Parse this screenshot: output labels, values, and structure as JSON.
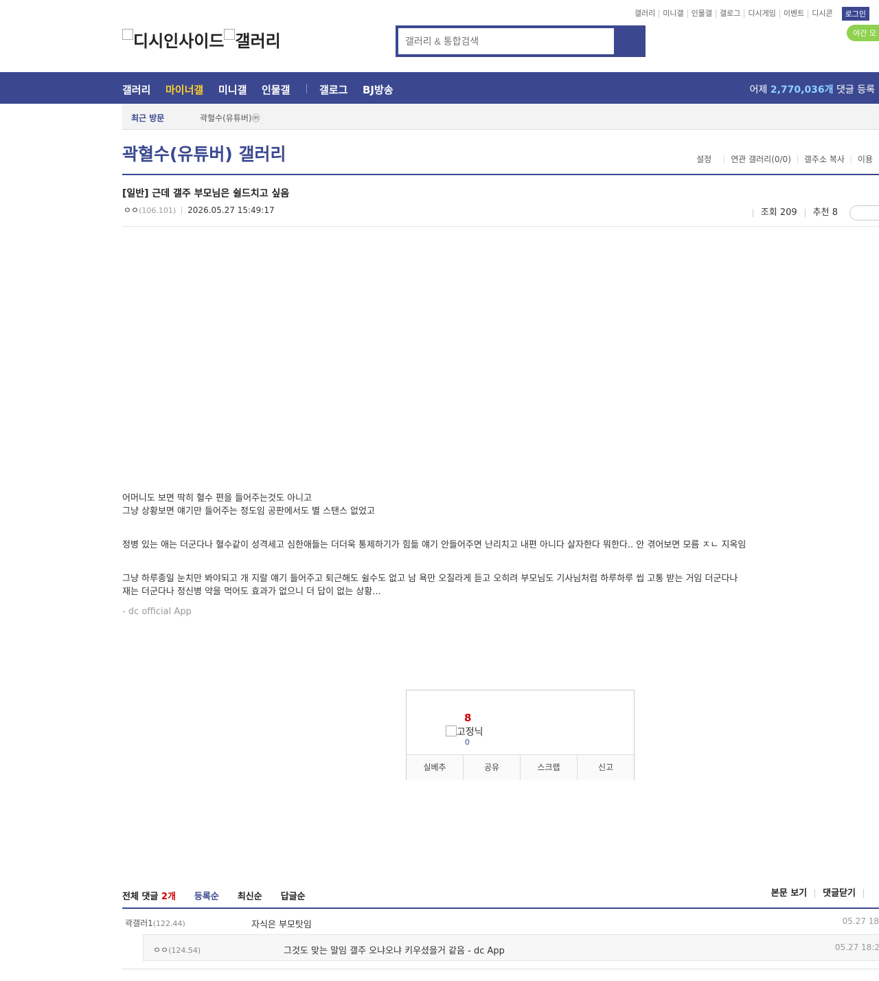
{
  "top_links": [
    "갤러리",
    "미니갤",
    "인물갤",
    "갤로그",
    "디시게임",
    "이벤트",
    "디시콘"
  ],
  "login_label": "로그인",
  "night_mode_label": "야간 모",
  "logo": {
    "left_alt": "디시인사이드",
    "right_alt": "갤러리"
  },
  "search": {
    "placeholder": "갤러리 & 통합검색"
  },
  "gnb": {
    "items": [
      "갤러리",
      "마이너갤",
      "미니갤",
      "인물갤"
    ],
    "items2": [
      "갤로그",
      "BJ방송"
    ],
    "stats_prefix": "어제",
    "stats_value": "2,770,036개",
    "stats_suffix": "댓글 등록"
  },
  "recent": {
    "label": "최근 방문",
    "gallery": "곽혈수(유튜버)ⓜ"
  },
  "gallery_title": "곽혈수(유튜버) 갤러리",
  "gallery_options": [
    "설정",
    "연관 갤러리(0/0)",
    "갤주소 복사",
    "이용"
  ],
  "post": {
    "title": "[일반] 근데 갤주 부모님은 쉴드치고 싶음",
    "author": "ㅇㅇ",
    "ip": "(106.101)",
    "date": "2026.05.27 15:49:17",
    "views": "조회 209",
    "recommend": "추천 8",
    "body": [
      "어머니도 보면 딱히 혈수 편을 들어주는것도 아니고",
      "그냥 상황보면 얘기만 들어주는 정도임 공판에서도 별 스탠스 없었고",
      "",
      "정병 있는 애는 더군다나 혈수같이 성격세고 심한애들는 더더욱 통제하기가 힘듦 얘기 안들어주면 난리치고 내편 아니다 살자한다 뭐한다.. 안 겪어보면 모름 ㅈㄴ 지옥임",
      "",
      "그냥 하루종일 눈치만 봐야되고 개 지랄 얘기 들어주고 퇴근해도 쉴수도 없고 남 욕만 오질라게 듣고 오히려 부모님도 기사님처럼 하루하루 씹 고통 받는 거임 더군다나 재는 더군다나 정신병 약을 먹어도 효과가 없으니 더 답이 없는 상황..."
    ],
    "app_signature": "- dc official App"
  },
  "recommend_box": {
    "count": "8",
    "fixed_nick_alt": "고정닉",
    "fixed_count": "0",
    "buttons": [
      "실베추",
      "공유",
      "스크랩",
      "신고"
    ]
  },
  "comments_header": {
    "label": "전체 댓글",
    "count": "2개",
    "sorts": [
      "등록순",
      "최신순",
      "답글순"
    ],
    "tools": [
      "본문 보기",
      "댓글닫기"
    ]
  },
  "comments": [
    {
      "nick": "곽갤러1",
      "ip": "(122.44)",
      "text": "자식은 부모탓임",
      "date": "05.27 18"
    },
    {
      "nick": "ㅇㅇ",
      "ip": "(124.54)",
      "text": "그것도 맞는 말임 갤주 오냐오냐 키우셨을거 같음 - dc App",
      "date": "05.27 18:2"
    }
  ],
  "colors": {
    "brand": "#3b4890",
    "accent_yellow": "#ffd02b",
    "recommend_red": "#cc0000",
    "night_green": "#8fd14f"
  }
}
